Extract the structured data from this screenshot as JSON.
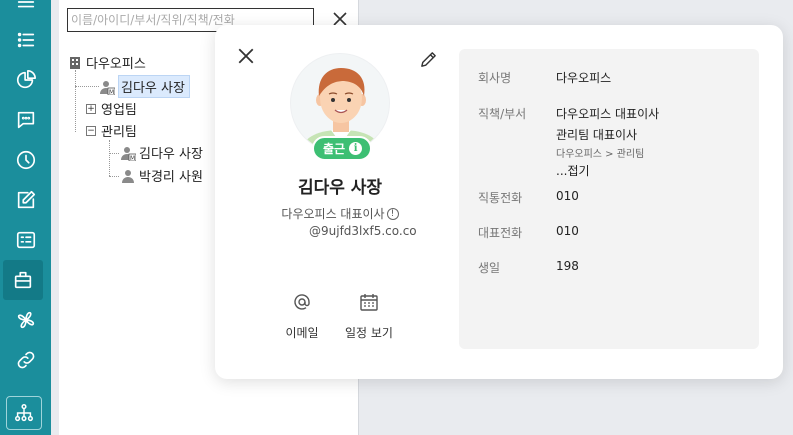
{
  "rail": {
    "items": [
      "menu-icon",
      "list-icon",
      "pie-chart-icon",
      "chat-icon",
      "clock-icon",
      "edit-icon",
      "id-card-icon",
      "briefcase-icon",
      "fan-icon",
      "link-icon"
    ],
    "bottom": "org-chart-icon",
    "color": "#1b8e9c",
    "active_color": "#137a87"
  },
  "org": {
    "search": {
      "placeholder": "이름/아이디/부서/직위/직책/전화",
      "value": ""
    },
    "tree": {
      "root": "다우오피스",
      "root_member": "김다우 사장",
      "sales": "영업팀",
      "admin": "관리팀",
      "admin_members": [
        "김다우 사장",
        "박경리 사원"
      ]
    }
  },
  "card": {
    "name": "김다우 사장",
    "status": "출근",
    "status_color": "#3dbf73",
    "title": "다우오피스 대표이사",
    "email": "@9ujfd3lxf5.co.co",
    "actions": {
      "email": "이메일",
      "schedule": "일정 보기"
    },
    "details": {
      "company": {
        "label": "회사명",
        "value": "다우오피스"
      },
      "position": {
        "label": "직책/부서",
        "values": [
          "다우오피스 대표이사",
          "관리팀 대표이사"
        ],
        "path": "다우오피스 > 관리팀",
        "toggle": "...접기"
      },
      "direct_phone": {
        "label": "직통전화",
        "value": "010"
      },
      "main_phone": {
        "label": "대표전화",
        "value": "010"
      },
      "birthday": {
        "label": "생일",
        "value": "198"
      }
    }
  }
}
